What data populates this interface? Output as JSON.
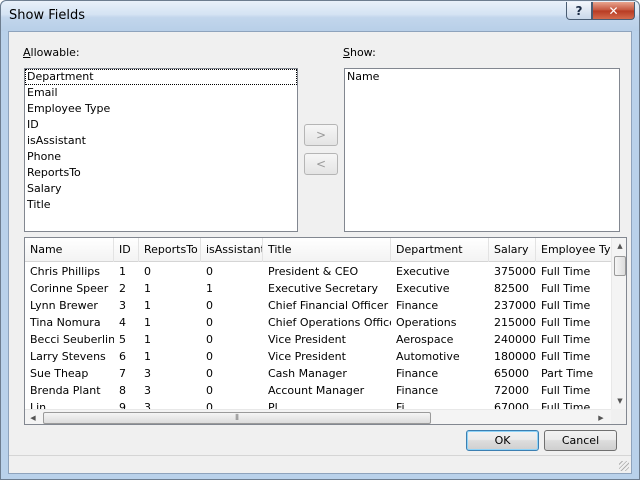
{
  "window": {
    "title": "Show Fields"
  },
  "titlebar_buttons": {
    "help": "?",
    "close": "✕"
  },
  "allowable": {
    "label_prefix": "",
    "label_access": "A",
    "label_rest": "llowable:",
    "items": [
      "Department",
      "Email",
      "Employee Type",
      "ID",
      "isAssistant",
      "Phone",
      "ReportsTo",
      "Salary",
      "Title"
    ]
  },
  "show": {
    "label_access": "S",
    "label_rest": "how:",
    "items": [
      "Name"
    ]
  },
  "move": {
    "add": ">",
    "remove": "<"
  },
  "grid": {
    "columns": [
      "Name",
      "ID",
      "ReportsTo",
      "isAssistant",
      "Title",
      "Department",
      "Salary",
      "Employee Type"
    ],
    "rows": [
      [
        "Chris Phillips",
        "1",
        "0",
        "0",
        "President & CEO",
        "Executive",
        "375000",
        "Full Time"
      ],
      [
        "Corinne Speer",
        "2",
        "1",
        "1",
        "Executive Secretary",
        "Executive",
        "82500",
        "Full Time"
      ],
      [
        "Lynn Brewer",
        "3",
        "1",
        "0",
        "Chief Financial Officer",
        "Finance",
        "237000",
        "Full Time"
      ],
      [
        "Tina Nomura",
        "4",
        "1",
        "0",
        "Chief Operations Officer",
        "Operations",
        "215000",
        "Full Time"
      ],
      [
        "Becci Seuberling",
        "5",
        "1",
        "0",
        "Vice President",
        "Aerospace",
        "240000",
        "Full Time"
      ],
      [
        "Larry Stevens",
        "6",
        "1",
        "0",
        "Vice President",
        "Automotive",
        "180000",
        "Full Time"
      ],
      [
        "Sue Theap",
        "7",
        "3",
        "0",
        "Cash Manager",
        "Finance",
        "65000",
        "Part Time"
      ],
      [
        "Brenda Plant",
        "8",
        "3",
        "0",
        "Account Manager",
        "Finance",
        "72000",
        "Full Time"
      ],
      [
        "Lin",
        "9",
        "3",
        "0",
        "Pl",
        "Fi",
        "67000",
        "Full Time"
      ]
    ]
  },
  "scroll": {
    "grip": "⦀"
  },
  "buttons": {
    "ok": "OK",
    "cancel": "Cancel"
  }
}
